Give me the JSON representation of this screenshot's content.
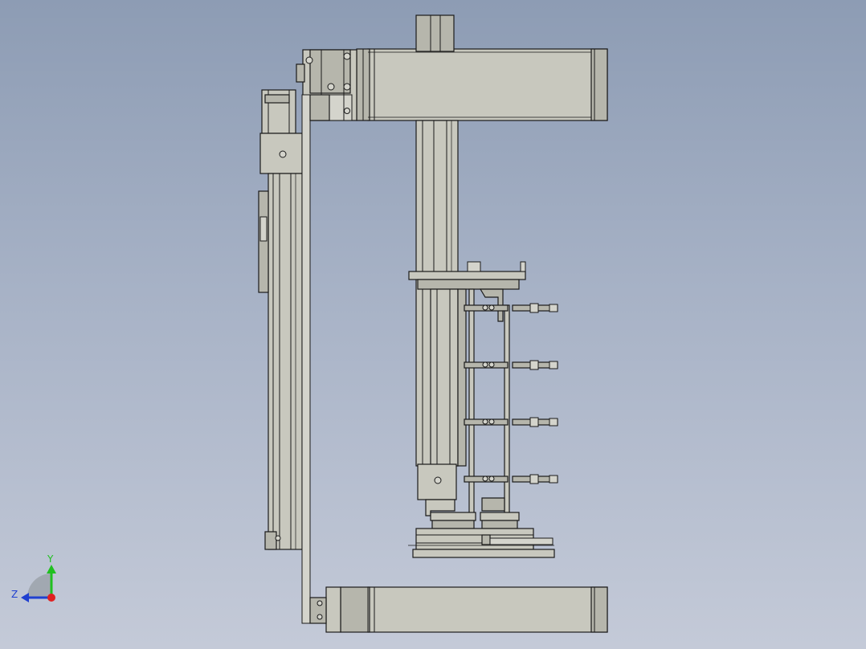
{
  "viewport": {
    "background_top": "#8d9cb4",
    "background_bottom": "#c4cad8",
    "part_fill": "#c8c8be",
    "part_fill_dark": "#b4b4aa",
    "edge_color": "#1a1a1a"
  },
  "triad": {
    "y_label": "Y",
    "z_label": "Z",
    "y_color": "#20c020",
    "z_color": "#2040d0",
    "x_color": "#e02020"
  }
}
